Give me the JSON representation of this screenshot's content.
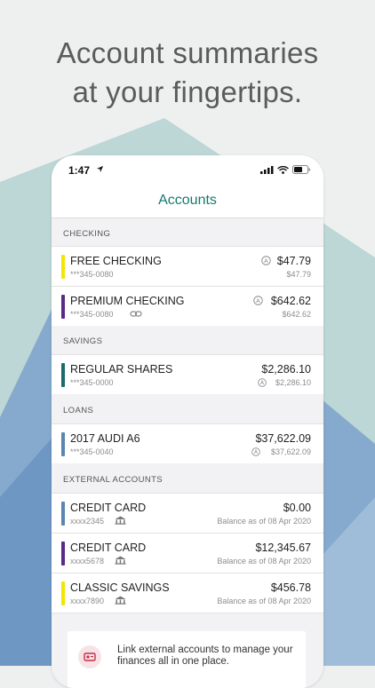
{
  "headline": {
    "line1": "Account summaries",
    "line2": "at your fingertips."
  },
  "status_bar": {
    "time": "1:47",
    "icons": [
      "location-arrow-icon",
      "cellular-signal-icon",
      "wifi-icon",
      "battery-icon"
    ]
  },
  "nav": {
    "title": "Accounts"
  },
  "colors": {
    "accent": "#14786e",
    "yellow": "#f3e600",
    "purple": "#5b2a86",
    "teal": "#1a6b6a",
    "steel": "#5b86b0"
  },
  "sections": {
    "checking": "CHECKING",
    "savings": "SAVINGS",
    "loans": "LOANS",
    "external": "EXTERNAL ACCOUNTS"
  },
  "accounts": [
    {
      "name": "FREE CHECKING",
      "number": "***345-0080",
      "amount": "$47.79",
      "sub": "$47.79",
      "color": "#f3e600",
      "icon": "available-balance-icon"
    },
    {
      "name": "PREMIUM CHECKING",
      "number": "***345-0080",
      "amount": "$642.62",
      "sub": "$642.62",
      "color": "#5b2a86",
      "icon": "available-balance-icon",
      "extra_icon": "link-icon"
    },
    {
      "name": "REGULAR SHARES",
      "number": "***345-0000",
      "amount": "$2,286.10",
      "sub": "$2,286.10",
      "color": "#1a6b6a",
      "icon": "available-balance-icon"
    },
    {
      "name": "2017 AUDI A6",
      "number": "***345-0040",
      "amount": "$37,622.09",
      "sub": "$37,622.09",
      "color": "#5b86b0",
      "icon": "available-balance-icon"
    },
    {
      "name": "CREDIT CARD",
      "number": "xxxx2345",
      "amount": "$0.00",
      "sub": "Balance as of 08 Apr 2020",
      "color": "#5b86b0",
      "icon": "bank-icon"
    },
    {
      "name": "CREDIT CARD",
      "number": "xxxx5678",
      "amount": "$12,345.67",
      "sub": "Balance as of 08 Apr 2020",
      "color": "#5b2a86",
      "icon": "bank-icon"
    },
    {
      "name": "CLASSIC SAVINGS",
      "number": "xxxx7890",
      "amount": "$456.78",
      "sub": "Balance as of 08 Apr 2020",
      "color": "#f3e600",
      "icon": "bank-icon"
    }
  ],
  "promo": {
    "text": "Link external accounts to manage your finances all in one place.",
    "icon": "link-accounts-icon"
  }
}
